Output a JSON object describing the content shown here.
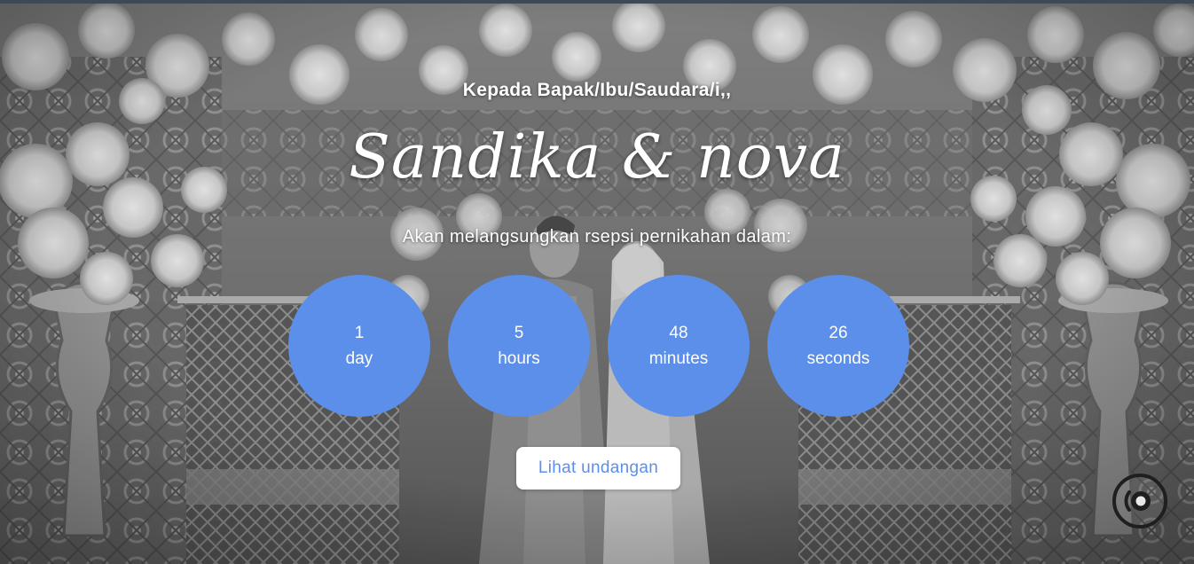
{
  "hero": {
    "greeting": "Kepada Bapak/Ibu/Saudara/i,,",
    "couple_names": "Sandika & nova",
    "subtitle": "Akan melangsungkan rsepsi pernikahan dalam:"
  },
  "countdown": [
    {
      "value": "1",
      "unit": "day"
    },
    {
      "value": "5",
      "unit": "hours"
    },
    {
      "value": "48",
      "unit": "minutes"
    },
    {
      "value": "26",
      "unit": "seconds"
    }
  ],
  "cta": {
    "label": "Lihat undangan"
  },
  "audio": {
    "icon": "audio-disc-icon"
  },
  "colors": {
    "accent": "#5b8fe9",
    "topbar": "#3c4a58",
    "text_light": "#ffffff",
    "button_bg": "#ffffff"
  }
}
